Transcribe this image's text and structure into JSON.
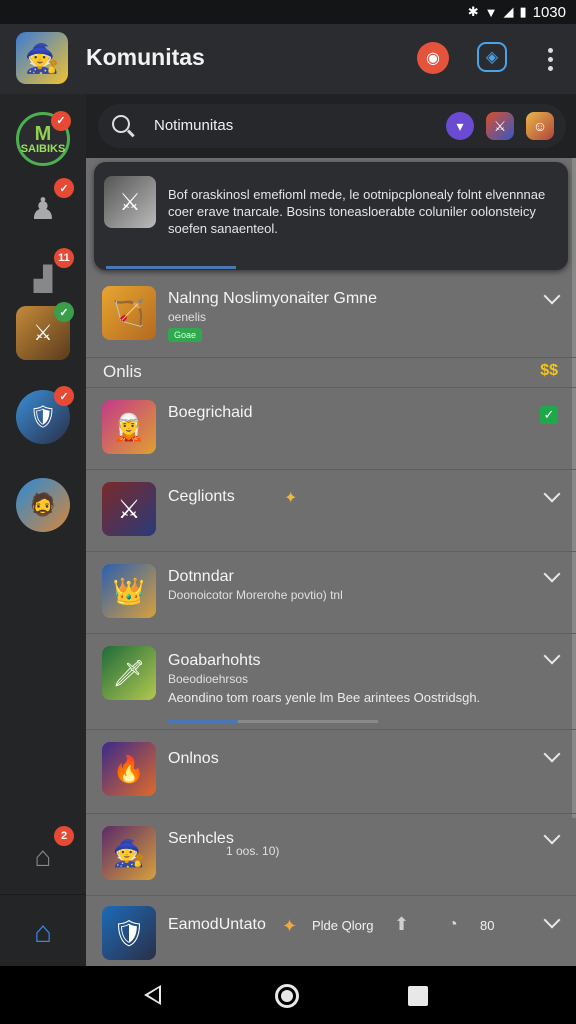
{
  "status_bar": {
    "time": "1030"
  },
  "app_bar": {
    "title": "Komunitas",
    "avatar_icon": "🧙",
    "notify_icon": "◉",
    "shield_icon": "◈"
  },
  "sidebar": {
    "logo_text": "SAIBIKS",
    "logo_big": "M",
    "badges": {
      "logo": "✓",
      "user": "✓",
      "chart": "11",
      "img1": "✓",
      "img2": "✓",
      "home_badge": "2"
    }
  },
  "search": {
    "placeholder": "Notimunitas"
  },
  "notice": {
    "text": "Bof oraskinosl emefioml mede, le ootnipcplonealy folnt elvennnae coer erave tnarcale. Bosins toneasloerabte coluniler oolonsteicy soefen sanaenteol."
  },
  "section": {
    "label": "Onlis",
    "badge": "$$"
  },
  "rows": [
    {
      "title": "Nalnng Noslimyonaiter Gmne",
      "sub": "oenelis",
      "pill": "Goae"
    },
    {
      "title": "Boegrichaid"
    },
    {
      "title": "Ceglionts"
    },
    {
      "title": "Dotnndar",
      "sub": "Doonoicotor Morerohe povtio) tnl"
    },
    {
      "title": "Goabarhohts",
      "sub": "Boeodioehrsos",
      "sub2": "Aeondino tom roars yenle lm Bee arintees Oostridsgh."
    },
    {
      "title": "Onlnos"
    },
    {
      "title": "Senhcles",
      "sub": "1 oos. 10)"
    },
    {
      "title": "EamodUntato",
      "extra1": "Plde Qlorg",
      "extra2": "80"
    }
  ]
}
